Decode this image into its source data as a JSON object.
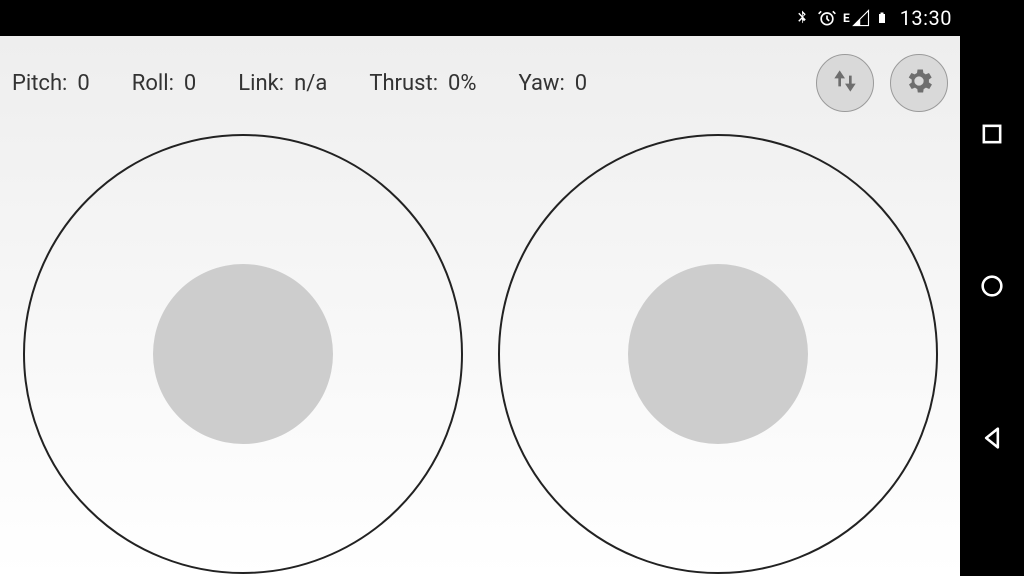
{
  "status_bar": {
    "network_letter": "E",
    "clock": "13:30"
  },
  "telemetry": {
    "pitch": {
      "label": "Pitch:",
      "value": "0"
    },
    "roll": {
      "label": "Roll:",
      "value": "0"
    },
    "link": {
      "label": "Link:",
      "value": "n/a"
    },
    "thrust": {
      "label": "Thrust:",
      "value": "0%"
    },
    "yaw": {
      "label": "Yaw:",
      "value": "0"
    }
  },
  "buttons": {
    "connect": "connect-button",
    "settings": "settings-button"
  }
}
